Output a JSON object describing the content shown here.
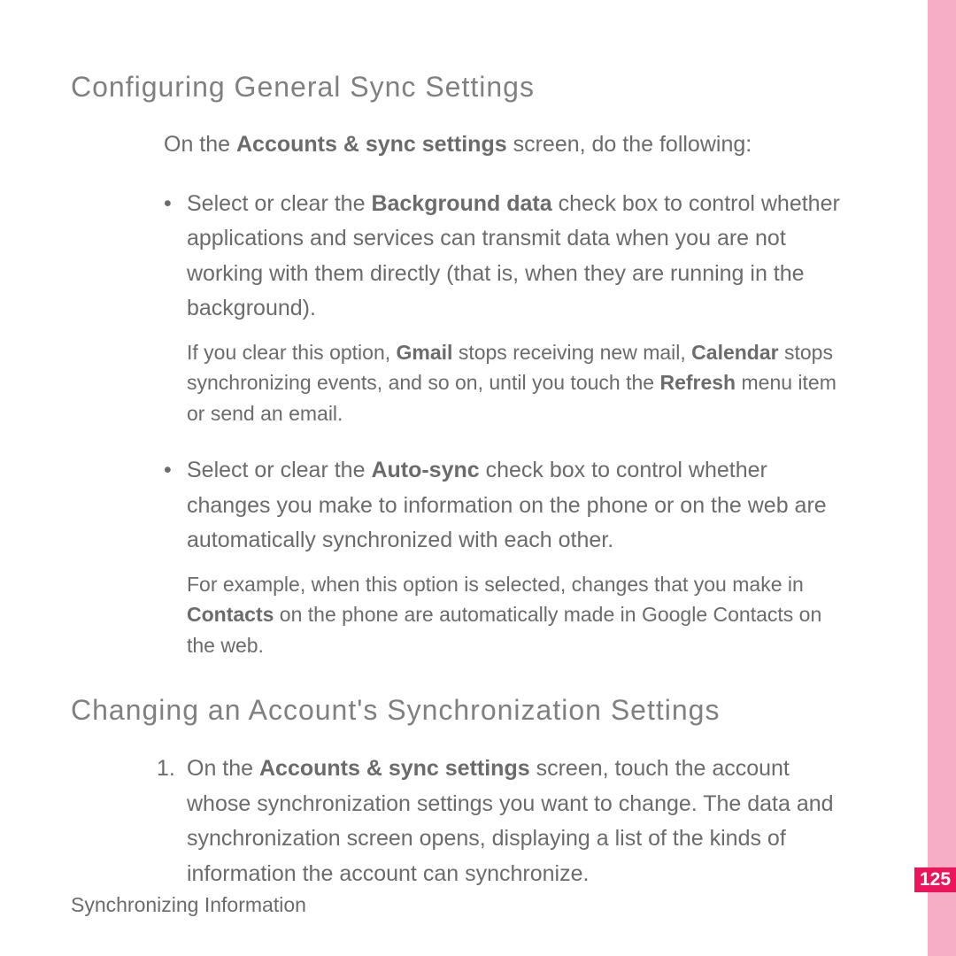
{
  "section1": {
    "heading": "Configuring General Sync Settings",
    "intro_prefix": "On the ",
    "intro_bold": "Accounts & sync settings",
    "intro_suffix": " screen, do the following:",
    "bullet1": {
      "p1": "Select or clear the ",
      "b1": "Background data",
      "p2": " check box to control whether applications and services can transmit data when you are not working with them directly (that is, when they are running in the background)."
    },
    "note1": {
      "p1": "If you clear this option, ",
      "b1": "Gmail",
      "p2": " stops receiving new mail, ",
      "b2": "Calendar",
      "p3": " stops synchronizing events, and so on, until you touch the ",
      "b3": "Refresh",
      "p4": " menu item or send an email."
    },
    "bullet2": {
      "p1": "Select or clear the ",
      "b1": "Auto-sync",
      "p2": " check box to control whether changes you make to information on the phone or on the web are automatically synchronized with each other."
    },
    "note2": {
      "p1": "For example, when this option is selected, changes that you make in ",
      "b1": "Contacts",
      "p2": " on the phone are automatically made in Google Contacts on the web."
    }
  },
  "section2": {
    "heading": "Changing an Account's Synchronization Settings",
    "item1": {
      "num": "1.",
      "p1": "On the ",
      "b1": "Accounts & sync settings",
      "p2": " screen, touch the account whose synchronization settings you want to change. The data and synchronization screen opens, displaying a list of the kinds of information the account can synchronize."
    }
  },
  "footer": "Synchronizing Information",
  "page_number": "125"
}
